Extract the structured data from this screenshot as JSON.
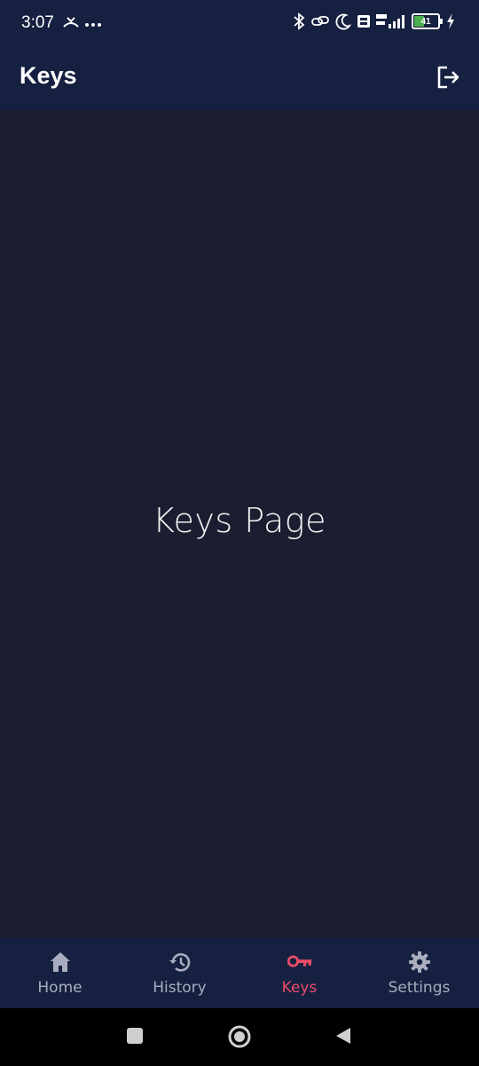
{
  "status_bar": {
    "time": "3:07",
    "battery": "41",
    "battery_level": 0.41
  },
  "app_bar": {
    "title": "Keys"
  },
  "main": {
    "page_label": "Keys Page"
  },
  "bottom_nav": {
    "items": [
      {
        "label": "Home",
        "icon": "home-icon"
      },
      {
        "label": "History",
        "icon": "history-icon"
      },
      {
        "label": "Keys",
        "icon": "key-icon",
        "active": true
      },
      {
        "label": "Settings",
        "icon": "gear-icon"
      }
    ]
  },
  "colors": {
    "header_bg": "#162040",
    "content_bg": "#1c1d30",
    "accent": "#e94d69",
    "inactive": "#a9adbf"
  }
}
